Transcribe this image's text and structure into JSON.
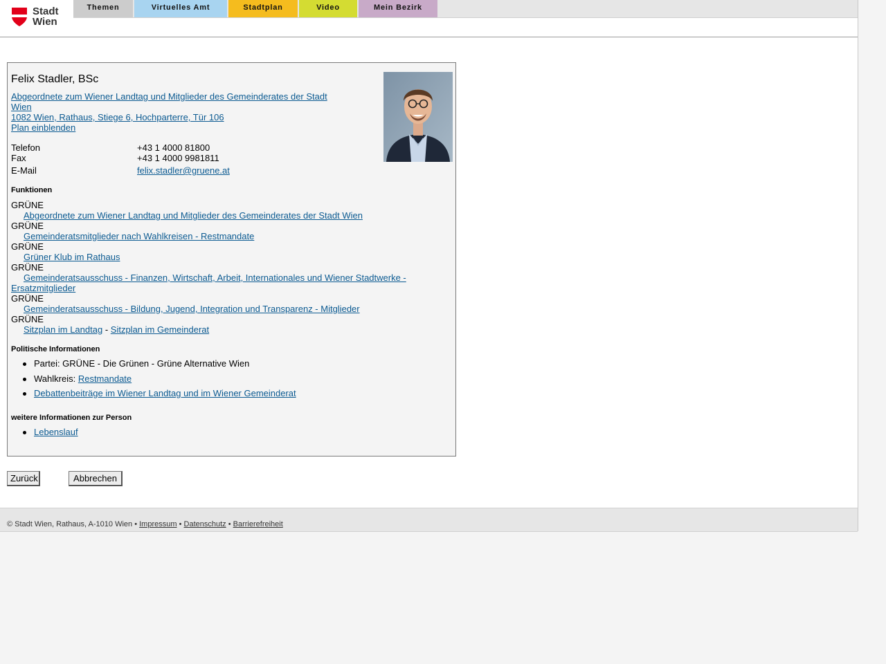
{
  "header": {
    "logo_line1": "Stadt",
    "logo_line2": "Wien",
    "tabs": [
      {
        "label": "Themen",
        "color": "#cccccc"
      },
      {
        "label": "Virtuelles Amt",
        "color": "#a8d4f0"
      },
      {
        "label": "Stadtplan",
        "color": "#f5bc1e"
      },
      {
        "label": "Video",
        "color": "#d4dc32"
      },
      {
        "label": "Mein Bezirk",
        "color": "#c8aac8"
      }
    ]
  },
  "person": {
    "name": "Felix Stadler, BSc",
    "role_line1": "Abgeordnete zum Wiener Landtag und Mitglieder des Gemeinderates der Stadt",
    "role_line2": "Wien",
    "address": "1082 Wien, Rathaus, Stiege 6, Hochparterre, Tür 106",
    "plan_link": "Plan einblenden",
    "contact": {
      "phone_label": "Telefon",
      "phone_value": "+43 1 4000 81800",
      "fax_label": "Fax",
      "fax_value": "+43 1 4000 9981811",
      "email_label": "E-Mail",
      "email_value": "felix.stadler@gruene.at"
    }
  },
  "functions": {
    "title": "Funktionen",
    "items": [
      {
        "party": "GRÜNE",
        "link": "Abgeordnete zum Wiener Landtag und Mitglieder des Gemeinderates der Stadt Wien"
      },
      {
        "party": "GRÜNE",
        "link": "Gemeinderatsmitglieder nach Wahlkreisen - Restmandate"
      },
      {
        "party": "GRÜNE",
        "link": "Grüner Klub im Rathaus"
      },
      {
        "party": "GRÜNE",
        "link_line1": "Gemeinderatsausschuss - Finanzen, Wirtschaft, Arbeit, Internationales und Wiener Stadtwerke -",
        "link_line2": "Ersatzmitglieder"
      },
      {
        "party": "GRÜNE",
        "link": "Gemeinderatsausschuss - Bildung, Jugend, Integration und Transparenz - Mitglieder"
      },
      {
        "party": "GRÜNE",
        "link_a": "Sitzplan im Landtag",
        "separator": "-",
        "link_b": "Sitzplan im Gemeinderat"
      }
    ]
  },
  "political": {
    "title": "Politische Informationen",
    "party_text": "Partei: GRÜNE - Die Grünen - Grüne Alternative Wien",
    "district_label": "Wahlkreis:",
    "district_link": "Restmandate",
    "debates_link": "Debattenbeiträge im Wiener Landtag und im Wiener Gemeinderat"
  },
  "more_info": {
    "title": "weitere Informationen zur Person",
    "cv_link": "Lebenslauf"
  },
  "buttons": {
    "back": "Zurück",
    "cancel": "Abbrechen"
  },
  "footer": {
    "copyright": "© Stadt Wien, Rathaus, A-1010 Wien •",
    "imprint": "Impressum",
    "privacy": "Datenschutz",
    "accessibility": "Barrierefreiheit",
    "sep": "•"
  }
}
